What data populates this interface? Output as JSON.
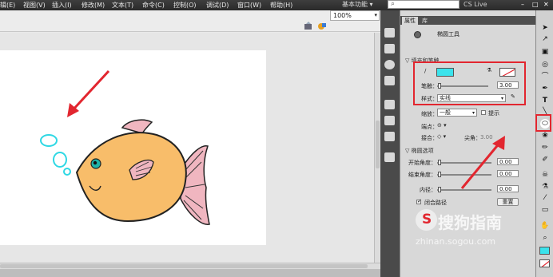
{
  "menubar": {
    "items": [
      "辑(E)",
      "视图(V)",
      "插入(I)",
      "修改(M)",
      "文本(T)",
      "命令(C)",
      "控制(O)",
      "调试(D)",
      "窗口(W)",
      "帮助(H)"
    ],
    "workspace": "基本功能 ▾",
    "cs_live": "CS Live"
  },
  "stage": {
    "zoom": "100%"
  },
  "properties": {
    "tabs": [
      "属性",
      "库"
    ],
    "tool_name": "椭圆工具",
    "fill_stroke_header": "▽ 填充和笔触",
    "stroke_label": "笔触：",
    "stroke_value": "3.00",
    "style_label": "样式：",
    "style_value": "实线",
    "scale_label": "缩放：",
    "scale_value": "一般",
    "hint_label": "提示",
    "cap_label": "端点：",
    "join_label": "接合：",
    "miter_label": "尖角：",
    "miter_value": "3.00",
    "ellipse_header": "▽ 椭圆选项",
    "start_angle_label": "开始角度：",
    "start_angle_value": "0.00",
    "end_angle_label": "结束角度：",
    "end_angle_value": "0.00",
    "inner_radius_label": "内径：",
    "inner_radius_value": "0.00",
    "close_path_label": "闭合路径",
    "reset_label": "重置"
  },
  "colors": {
    "fill": "#3be3ec",
    "highlight": "#e2262f",
    "fish_body": "#f8bd6a",
    "fin": "#f0b6c0",
    "bubble": "#2fd8e4"
  },
  "watermark": {
    "logo_text": "S",
    "text": "搜狗指南",
    "url": "zhinan.sogou.com"
  }
}
